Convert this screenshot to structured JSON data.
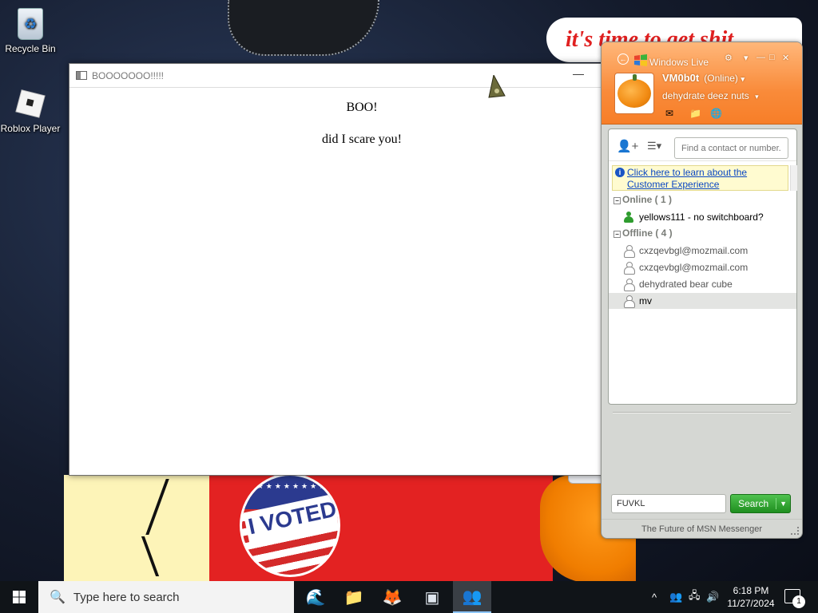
{
  "wallpaper": {
    "slogan": "it's time to get shit",
    "badge_text": "I VOTED",
    "badge_stars": "★★★★★★★★"
  },
  "desktop": {
    "icons": [
      {
        "label": "Recycle Bin",
        "icon": "recycle-bin-icon"
      },
      {
        "label": "Roblox Player",
        "icon": "roblox-icon"
      }
    ]
  },
  "boo_window": {
    "title": "BOOOOOOO!!!!!",
    "minimize_glyph": "—",
    "heading": "BOO!",
    "message": "did I scare you!"
  },
  "side_tabs": [
    {
      "icon": "contacts-buddy-icon",
      "glyph": "👤"
    },
    {
      "icon": "bell-icon",
      "glyph": "🔔"
    },
    {
      "icon": "butterfly-icon",
      "glyph": "🦋"
    }
  ],
  "messenger": {
    "title": "Windows Live",
    "back_glyph": "←",
    "title_buttons": [
      "⚙",
      "▾",
      "—",
      "□",
      "✕"
    ],
    "display_name": "VM0b0t",
    "status": "(Online)",
    "status_caret": "▾",
    "personal_message": "dehydrate deez nuts",
    "psm_caret": "▾",
    "quick_icons": [
      "✉",
      "📁",
      "🌐"
    ],
    "add_contact_glyph": "👤+",
    "view_glyph": "☰▾",
    "search_placeholder": "Find a contact or number...",
    "info_link": "Click here to learn about the Customer Experience",
    "groups": [
      {
        "label": "Online ( 1 )",
        "toggle": "−"
      },
      {
        "label": "Offline ( 4 )",
        "toggle": "−"
      }
    ],
    "online_contacts": [
      {
        "name": "yellows111 - no switchboard?"
      }
    ],
    "offline_contacts": [
      {
        "name": "cxzqevbgl@mozmail.com"
      },
      {
        "name": "cxzqevbgl@mozmail.com"
      },
      {
        "name": "dehydrated bear cube"
      },
      {
        "name": "mv"
      }
    ],
    "bottom_input_value": "FUVKL",
    "search_button": "Search",
    "search_dropdown_glyph": "▼",
    "footer": "The Future of MSN Messenger"
  },
  "taskbar": {
    "search_placeholder": "Type here to search",
    "search_glyph": "🔍",
    "apps": [
      {
        "name": "edge-icon",
        "glyph": "🌊"
      },
      {
        "name": "file-explorer-icon",
        "glyph": "📁"
      },
      {
        "name": "firefox-icon",
        "glyph": "🦊"
      },
      {
        "name": "app-window-icon",
        "glyph": "▣"
      },
      {
        "name": "messenger-icon",
        "glyph": "👥"
      }
    ],
    "tray_glyphs": [
      "^",
      "👥",
      "🖧",
      "🔊"
    ],
    "time": "6:18 PM",
    "date": "11/27/2024",
    "notification_count": "1"
  },
  "colors": {
    "msn_orange": "#f98b3a",
    "search_green": "#1f8e1f",
    "link_blue": "#0a47c2",
    "online_green": "#2e9c2e"
  }
}
